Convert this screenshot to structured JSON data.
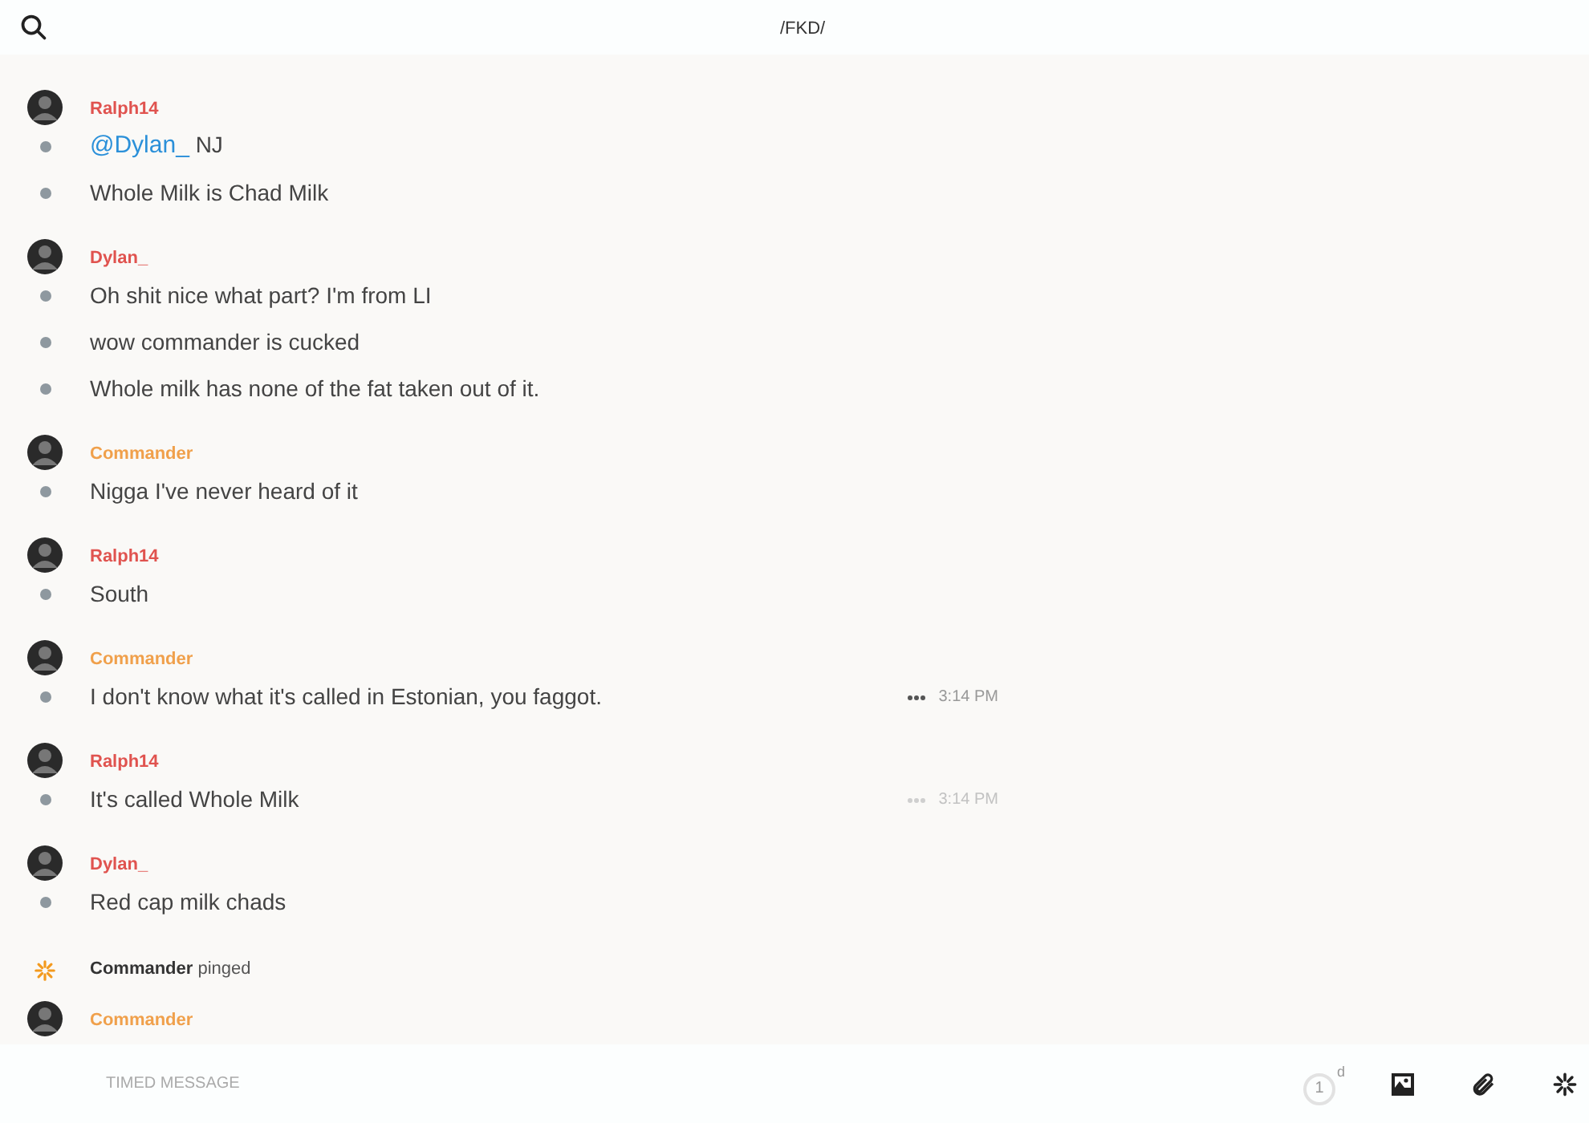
{
  "header": {
    "title": "/FKD/"
  },
  "feed": [
    {
      "kind": "group",
      "author": "Ralph14",
      "color": "#e0534f",
      "messages": [
        {
          "mention": "@Dylan_",
          "text": "NJ"
        },
        {
          "text": "Whole Milk is Chad Milk"
        }
      ]
    },
    {
      "kind": "group",
      "author": "Dylan_",
      "color": "#e0534f",
      "messages": [
        {
          "text": "Oh shit nice what part? I'm from LI"
        },
        {
          "text": "wow commander is cucked"
        },
        {
          "text": "Whole milk has none of the fat taken out of it."
        }
      ]
    },
    {
      "kind": "group",
      "author": "Commander",
      "color": "#f0a04b",
      "messages": [
        {
          "text": "Nigga I've never heard of it"
        }
      ]
    },
    {
      "kind": "group",
      "author": "Ralph14",
      "color": "#e0534f",
      "messages": [
        {
          "text": "South"
        }
      ]
    },
    {
      "kind": "group",
      "author": "Commander",
      "color": "#f0a04b",
      "messages": [
        {
          "text": "I don't know what it's called in Estonian, you faggot.",
          "time": "3:14 PM",
          "hovered": true
        }
      ]
    },
    {
      "kind": "group",
      "author": "Ralph14",
      "color": "#e0534f",
      "messages": [
        {
          "text": "It's called Whole Milk",
          "time": "3:14 PM",
          "hovered": false
        }
      ]
    },
    {
      "kind": "group",
      "author": "Dylan_",
      "color": "#e0534f",
      "messages": [
        {
          "text": "Red cap milk chads"
        }
      ]
    },
    {
      "kind": "ping",
      "author": "Commander",
      "action": "pinged"
    },
    {
      "kind": "group",
      "author": "Commander",
      "color": "#f0a04b"
    }
  ],
  "composer": {
    "placeholder": "TIMED MESSAGE",
    "timer": "1",
    "timer_unit": "d"
  }
}
